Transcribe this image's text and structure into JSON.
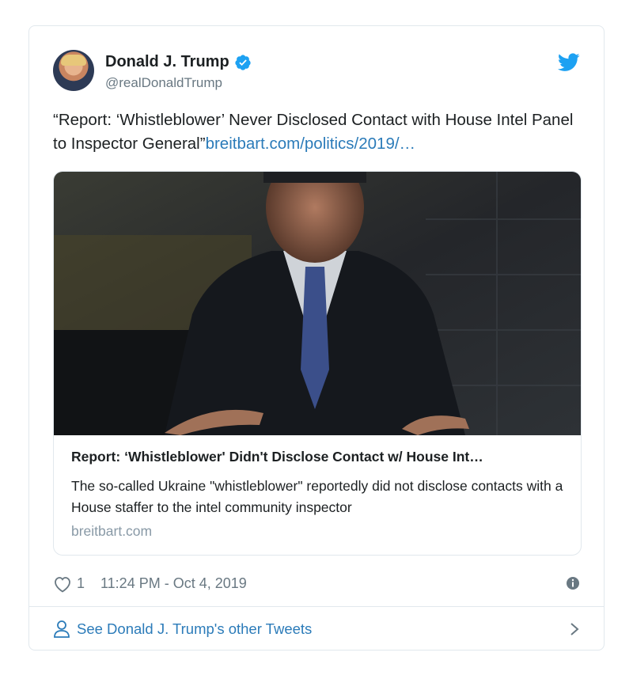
{
  "author": {
    "name": "Donald J. Trump",
    "handle": "@realDonaldTrump",
    "verified": true
  },
  "tweet": {
    "text": "“Report: ‘Whistleblower’ Never Disclosed Contact with House Intel Panel to Inspector General”",
    "link_text": "breitbart.com/politics/2019/…"
  },
  "link_card": {
    "title": "Report: ‘Whistleblower' Didn't Disclose Contact w/ House Int…",
    "description": "The so-called Ukraine \"whistleblower\" reportedly did not disclose contacts with a House staffer to the intel community inspector",
    "domain": "breitbart.com"
  },
  "meta": {
    "like_count": "1",
    "timestamp": "11:24 PM - Oct 4, 2019"
  },
  "footer": {
    "label": "See Donald J. Trump's other Tweets"
  },
  "icons": {
    "verified": "verified-badge-icon",
    "brand": "twitter-bird-icon",
    "like": "heart-icon",
    "info": "info-icon",
    "profile": "person-icon",
    "chevron": "chevron-right-icon"
  },
  "colors": {
    "link": "#2b7bb9",
    "brand": "#1da1f2",
    "muted": "#697882",
    "border": "#e1e8ed"
  }
}
